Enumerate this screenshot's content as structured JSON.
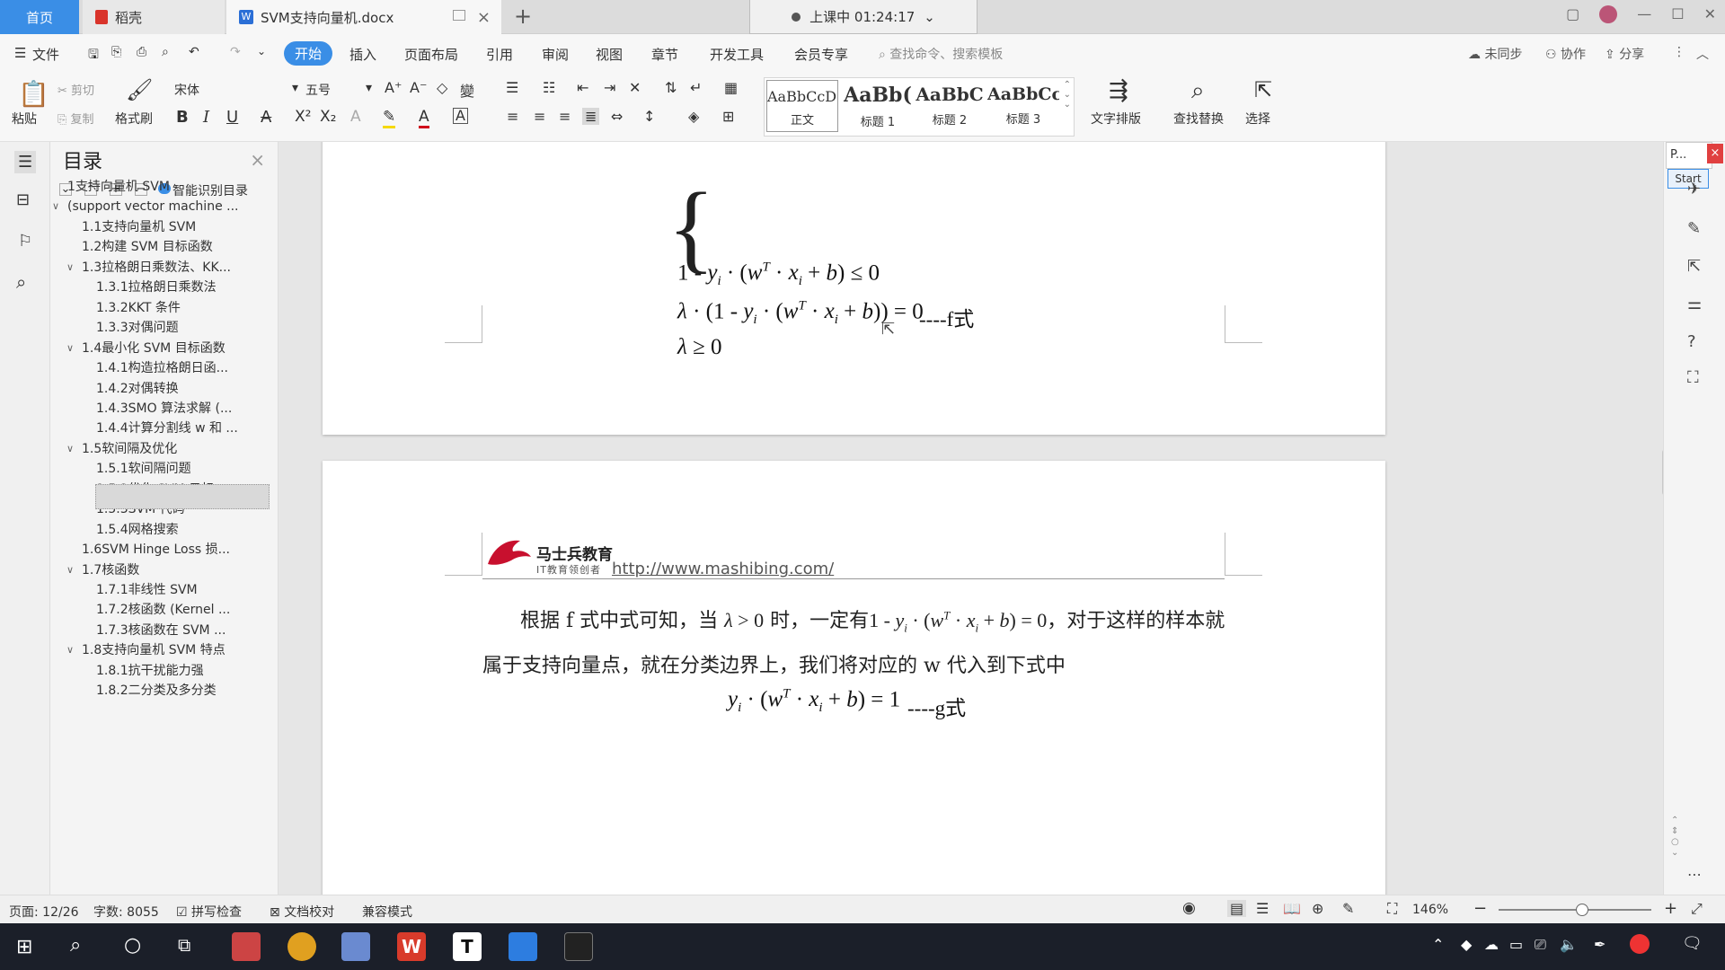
{
  "tabs": {
    "home": "首页",
    "daoke": "稻壳",
    "doc": "SVM支持向量机.docx"
  },
  "timer": {
    "label": "上课中 01:24:17"
  },
  "menu": {
    "file": "文件",
    "items": [
      "开始",
      "插入",
      "页面布局",
      "引用",
      "审阅",
      "视图",
      "章节",
      "开发工具",
      "会员专享"
    ],
    "search_placeholder": "查找命令、搜索模板",
    "sync": "未同步",
    "collab": "协作",
    "share": "分享"
  },
  "ribbon": {
    "paste": "粘贴",
    "cut": "剪切",
    "copy": "复制",
    "format_painter": "格式刷",
    "font_name": "宋体",
    "font_size": "五号",
    "styles": [
      {
        "sample": "AaBbCcDd",
        "name": "正文"
      },
      {
        "sample": "AaBb(",
        "name": "标题 1"
      },
      {
        "sample": "AaBbC",
        "name": "标题 2"
      },
      {
        "sample": "AaBbCc",
        "name": "标题 3"
      }
    ],
    "text_layout": "文字排版",
    "find_replace": "查找替换",
    "select": "选择"
  },
  "toc": {
    "title": "目录",
    "smart": "智能识别目录",
    "items": [
      {
        "label": "1支持向量机 SVM",
        "level": 1,
        "arrow": ""
      },
      {
        "label": "(support vector machine ...",
        "level": 1,
        "arrow": "v"
      },
      {
        "label": "1.1支持向量机 SVM",
        "level": 2,
        "arrow": ""
      },
      {
        "label": "1.2构建 SVM 目标函数",
        "level": 2,
        "arrow": ""
      },
      {
        "label": "1.3拉格朗日乘数法、KK...",
        "level": 2,
        "arrow": "v"
      },
      {
        "label": "1.3.1拉格朗日乘数法",
        "level": 3,
        "arrow": ""
      },
      {
        "label": "1.3.2KKT 条件",
        "level": 3,
        "arrow": ""
      },
      {
        "label": "1.3.3对偶问题",
        "level": 3,
        "arrow": ""
      },
      {
        "label": "1.4最小化 SVM 目标函数",
        "level": 2,
        "arrow": "v"
      },
      {
        "label": "1.4.1构造拉格朗日函...",
        "level": 3,
        "arrow": ""
      },
      {
        "label": "1.4.2对偶转换",
        "level": 3,
        "arrow": ""
      },
      {
        "label": "1.4.3SMO 算法求解 (...",
        "level": 3,
        "arrow": ""
      },
      {
        "label": "1.4.4计算分割线 w 和 ...",
        "level": 3,
        "arrow": ""
      },
      {
        "label": "1.5软间隔及优化",
        "level": 2,
        "arrow": "v"
      },
      {
        "label": "1.5.1软间隔问题",
        "level": 3,
        "arrow": ""
      },
      {
        "label": "1.5.2优化 SVM 目标...",
        "level": 3,
        "arrow": ""
      },
      {
        "label": "1.5.3SVM 代码",
        "level": 3,
        "arrow": ""
      },
      {
        "label": "1.5.4网格搜索",
        "level": 3,
        "arrow": ""
      },
      {
        "label": "1.6SVM Hinge Loss 损...",
        "level": 2,
        "arrow": ""
      },
      {
        "label": "1.7核函数",
        "level": 2,
        "arrow": "v"
      },
      {
        "label": "1.7.1非线性 SVM",
        "level": 3,
        "arrow": ""
      },
      {
        "label": "1.7.2核函数 (Kernel ...",
        "level": 3,
        "arrow": ""
      },
      {
        "label": "1.7.3核函数在 SVM ...",
        "level": 3,
        "arrow": ""
      },
      {
        "label": "1.8支持向量机 SVM 特点",
        "level": 2,
        "arrow": "v"
      },
      {
        "label": "1.8.1抗干扰能力强",
        "level": 3,
        "arrow": ""
      },
      {
        "label": "1.8.2二分类及多分类",
        "level": 3,
        "arrow": ""
      }
    ]
  },
  "doc": {
    "eq_f_tag": "----f式",
    "eq_g_tag": "----g式",
    "logo_name": "马士兵教育",
    "logo_sub": "IT教育领创者",
    "url": "http://www.mashibing.com/",
    "para_1a": "根据 f 式中式可知，当",
    "para_1b": "时，一定有",
    "para_1c": "，对于这样的样本就",
    "para_2": "属于支持向量点，就在分类边界上，我们将对应的 w 代入到下式中"
  },
  "ppt_mini": {
    "title": "P...",
    "start": "Start"
  },
  "status": {
    "page": "页面: 12/26",
    "words": "字数: 8055",
    "spell": "拼写检查",
    "proof": "文档校对",
    "compat": "兼容模式",
    "zoom": "146%"
  }
}
